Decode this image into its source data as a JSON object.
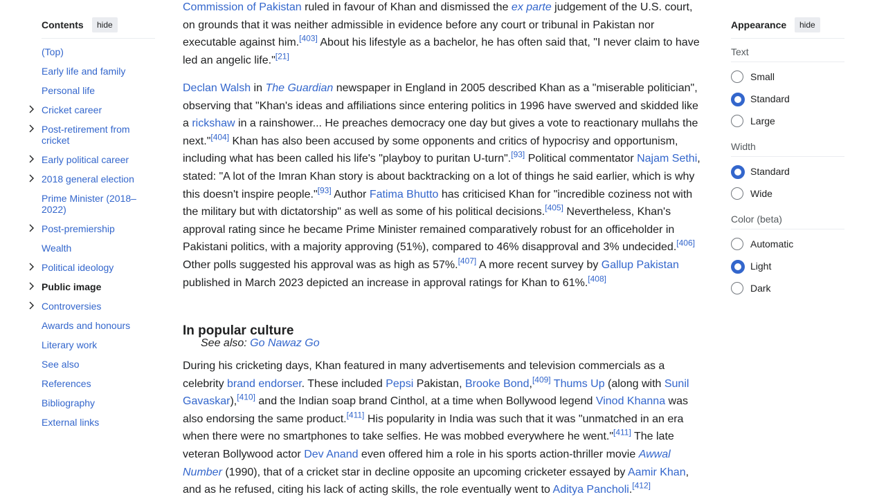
{
  "toc": {
    "title": "Contents",
    "hide_label": "hide",
    "items": [
      {
        "label": "(Top)",
        "expandable": false,
        "active": false
      },
      {
        "label": "Early life and family",
        "expandable": false,
        "active": false
      },
      {
        "label": "Personal life",
        "expandable": false,
        "active": false
      },
      {
        "label": "Cricket career",
        "expandable": true,
        "active": false
      },
      {
        "label": "Post-retirement from cricket",
        "expandable": true,
        "active": false
      },
      {
        "label": "Early political career",
        "expandable": true,
        "active": false
      },
      {
        "label": "2018 general election",
        "expandable": true,
        "active": false
      },
      {
        "label": "Prime Minister (2018–2022)",
        "expandable": false,
        "active": false
      },
      {
        "label": "Post-premiership",
        "expandable": true,
        "active": false
      },
      {
        "label": "Wealth",
        "expandable": false,
        "active": false
      },
      {
        "label": "Political ideology",
        "expandable": true,
        "active": false
      },
      {
        "label": "Public image",
        "expandable": true,
        "active": true
      },
      {
        "label": "Controversies",
        "expandable": true,
        "active": false
      },
      {
        "label": "Awards and honours",
        "expandable": false,
        "active": false
      },
      {
        "label": "Literary work",
        "expandable": false,
        "active": false
      },
      {
        "label": "See also",
        "expandable": false,
        "active": false
      },
      {
        "label": "References",
        "expandable": false,
        "active": false
      },
      {
        "label": "Bibliography",
        "expandable": false,
        "active": false
      },
      {
        "label": "External links",
        "expandable": false,
        "active": false
      }
    ]
  },
  "article": {
    "p1": {
      "link_commission": "Commission of Pakistan",
      "t1": " ruled in favour of Khan and dismissed the ",
      "ex_parte": "ex parte",
      "t2": " judgement of the U.S. court, on grounds that it was neither admissible in evidence before any court or tribunal in Pakistan nor executable against him.",
      "ref_403": "[403]",
      "t3": " About his lifestyle as a bachelor, he has often said that, \"I never claim to have led an angelic life.\"",
      "ref_21": "[21]"
    },
    "p2": {
      "link_walsh": "Declan Walsh",
      "t1": " in ",
      "link_guardian": "The Guardian",
      "t2": " newspaper in England in 2005 described Khan as a \"miserable politician\", observing that \"Khan's ideas and affiliations since entering politics in 1996 have swerved and skidded like a ",
      "link_rickshaw": "rickshaw",
      "t3": " in a rainshower... He preaches democracy one day but gives a vote to reactionary mullahs the next.\"",
      "ref_404": "[404]",
      "t4": " Khan has also been accused by some opponents and critics of hypocrisy and opportunism, including what has been called his life's \"playboy to puritan U-turn\".",
      "ref_93a": "[93]",
      "t5": " Political commentator ",
      "link_sethi": "Najam Sethi",
      "t6": ", stated: \"A lot of the Imran Khan story is about backtracking on a lot of things he said earlier, which is why this doesn't inspire people.\"",
      "ref_93b": "[93]",
      "t7": " Author ",
      "link_bhutto": "Fatima Bhutto",
      "t8": " has criticised Khan for \"incredible coziness not with the military but with dictatorship\" as well as some of his political decisions.",
      "ref_405": "[405]",
      "t9": " Nevertheless, Khan's approval rating since he became Prime Minister remained comparatively robust for an officeholder in Pakistani politics, with a majority approving (51%), compared to 46% disapproval and 3% undecided.",
      "ref_406": "[406]",
      "t10": " Other polls suggested his approval was as high as 57%.",
      "ref_407": "[407]",
      "t11": " A more recent survey by ",
      "link_gallup": "Gallup Pakistan",
      "t12": " published in March 2023 depicted an increase in approval ratings for Khan to 61%.",
      "ref_408": "[408]"
    },
    "heading": "In popular culture",
    "see_also_prefix": "See also: ",
    "see_also_link": "Go Nawaz Go",
    "p3": {
      "t1": "During his cricketing days, Khan featured in many advertisements and television commercials as a celebrity ",
      "link_brand": "brand endorser",
      "t2": ". These included ",
      "link_pepsi": "Pepsi",
      "t3": " Pakistan, ",
      "link_bond": "Brooke Bond",
      "t4": ",",
      "ref_409": "[409]",
      "t5": " ",
      "link_thums": "Thums Up",
      "t6": " (along with ",
      "link_gavaskar": "Sunil Gavaskar",
      "t7": "),",
      "ref_410": "[410]",
      "t8": " and the Indian soap brand Cinthol, at a time when Bollywood legend ",
      "link_khanna": "Vinod Khanna",
      "t9": " was also endorsing the same product.",
      "ref_411a": "[411]",
      "t10": " His popularity in India was such that it was \"unmatched in an era when there were no smartphones to take selfies. He was mobbed everywhere he went.\"",
      "ref_411b": "[411]",
      "t11": " The late veteran Bollywood actor ",
      "link_anand": "Dev Anand",
      "t12": " even offered him a role in his sports action-thriller movie ",
      "awwal": "Awwal Number",
      "t13": " (1990), that of a cricket star in decline opposite an upcoming cricketer essayed by ",
      "link_aamir": "Aamir Khan",
      "t14": ", and as he refused, citing his lack of acting skills, the role eventually went to ",
      "link_pancholi": "Aditya Pancholi",
      "t15": ".",
      "ref_412": "[412]"
    }
  },
  "appearance": {
    "title": "Appearance",
    "hide_label": "hide",
    "text_label": "Text",
    "text_options": [
      {
        "label": "Small",
        "selected": false
      },
      {
        "label": "Standard",
        "selected": true
      },
      {
        "label": "Large",
        "selected": false
      }
    ],
    "width_label": "Width",
    "width_options": [
      {
        "label": "Standard",
        "selected": true
      },
      {
        "label": "Wide",
        "selected": false
      }
    ],
    "color_label": "Color (beta)",
    "color_options": [
      {
        "label": "Automatic",
        "selected": false
      },
      {
        "label": "Light",
        "selected": true
      },
      {
        "label": "Dark",
        "selected": false
      }
    ]
  },
  "colors": {
    "link": "#3366cc",
    "text": "#202122",
    "radio_on": "#3366cc"
  }
}
